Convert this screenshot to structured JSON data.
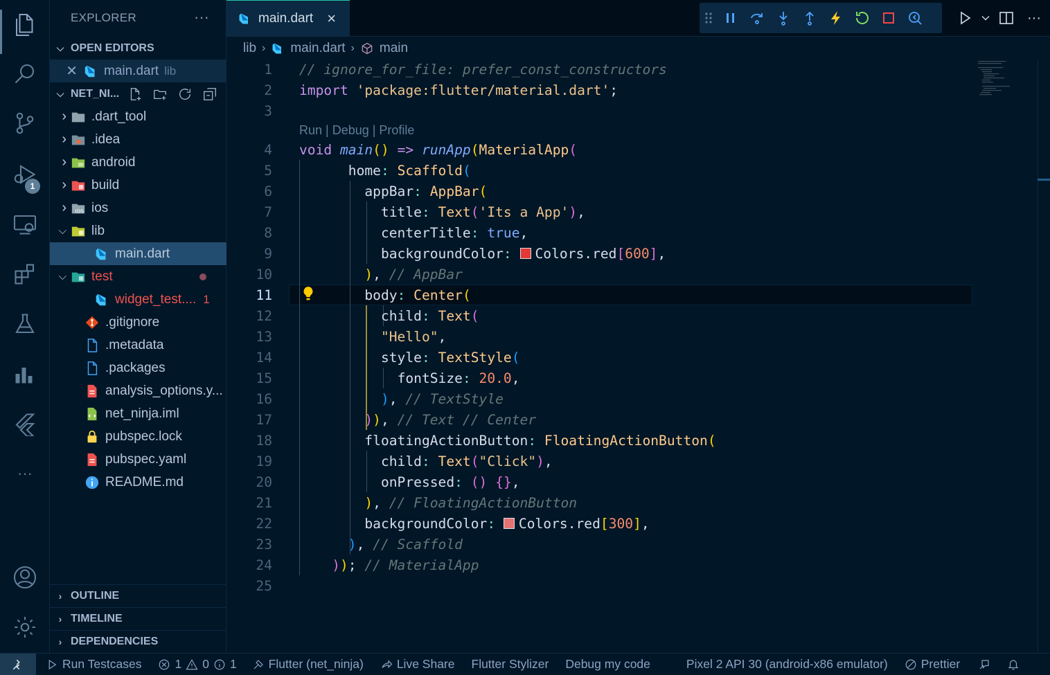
{
  "explorer": {
    "title": "EXPLORER",
    "more": "···",
    "open_editors_label": "OPEN EDITORS",
    "open_editor_file": "main.dart",
    "open_editor_dir": "lib",
    "project_label": "NET_NI...",
    "tree": [
      {
        "label": ".dart_tool",
        "icon": "folder-icon"
      },
      {
        "label": ".idea",
        "icon": "idea-folder-icon"
      },
      {
        "label": "android",
        "icon": "android-folder-icon"
      },
      {
        "label": "build",
        "icon": "build-folder-icon"
      },
      {
        "label": "ios",
        "icon": "ios-folder-icon"
      },
      {
        "label": "lib",
        "icon": "lib-folder-icon"
      },
      {
        "label": "main.dart",
        "icon": "dart-file-icon"
      },
      {
        "label": "test",
        "icon": "test-folder-icon"
      },
      {
        "label": "widget_test....",
        "icon": "dart-file-icon",
        "errors": "1"
      },
      {
        "label": ".gitignore",
        "icon": "git-icon"
      },
      {
        "label": ".metadata",
        "icon": "file-icon"
      },
      {
        "label": ".packages",
        "icon": "file-icon"
      },
      {
        "label": "analysis_options.y...",
        "icon": "yaml-icon"
      },
      {
        "label": "net_ninja.iml",
        "icon": "iml-icon"
      },
      {
        "label": "pubspec.lock",
        "icon": "lock-icon"
      },
      {
        "label": "pubspec.yaml",
        "icon": "yaml-icon"
      },
      {
        "label": "README.md",
        "icon": "info-icon"
      }
    ],
    "outline_label": "OUTLINE",
    "timeline_label": "TIMELINE",
    "dependencies_label": "DEPENDENCIES"
  },
  "activity_badge": "1",
  "tab": {
    "label": "main.dart",
    "close": "×"
  },
  "breadcrumb": {
    "folder": "lib",
    "file": "main.dart",
    "symbol": "main"
  },
  "codelens": "Run | Debug | Profile",
  "line_numbers": [
    "1",
    "2",
    "3",
    "4",
    "5",
    "6",
    "7",
    "8",
    "9",
    "10",
    "11",
    "12",
    "13",
    "14",
    "15",
    "16",
    "17",
    "18",
    "19",
    "20",
    "21",
    "22",
    "23",
    "24",
    "25"
  ],
  "code": {
    "l1": "// ignore_for_file: prefer_const_constructors",
    "l2_kw": "import",
    "l2_str": "'package:flutter/material.dart'",
    "l4_void": "void",
    "l4_main": "main",
    "l4_runapp": "runApp",
    "l4_material": "MaterialApp",
    "l5_home": "home",
    "l5_scaffold": "Scaffold",
    "l6_appbar": "appBar",
    "l6_appbar_cls": "AppBar",
    "l7_title": "title",
    "l7_text": "Text",
    "l7_str": "'Its a App'",
    "l8_center": "centerTitle",
    "l8_true": "true",
    "l9_bg": "backgroundColor",
    "l9_colors": "Colors.red",
    "l9_num": "600",
    "l10_comment": "// AppBar",
    "l11_body": "body",
    "l11_center": "Center",
    "l12_child": "child",
    "l12_text": "Text",
    "l13_str": "\"Hello\"",
    "l14_style": "style",
    "l14_ts": "TextStyle",
    "l15_fs": "fontSize",
    "l15_num": "20.0",
    "l16_comment": "// TextStyle",
    "l17_comment": "// Text // Center",
    "l18_fab": "floatingActionButton",
    "l18_fab_cls": "FloatingActionButton",
    "l19_child": "child",
    "l19_text": "Text",
    "l19_str": "\"Click\"",
    "l20_onp": "onPressed",
    "l21_comment": "// FloatingActionButton",
    "l22_bg": "backgroundColor",
    "l22_colors": "Colors.red",
    "l22_num": "300",
    "l23_comment": "// Scaffold",
    "l24_comment": "// MaterialApp"
  },
  "colors": {
    "red600": "#e53935",
    "red300": "#e57373",
    "accent": "#21c7a8"
  },
  "status": {
    "run_testcases": "Run Testcases",
    "errors": "1",
    "warnings": "0",
    "infos": "1",
    "flutter": "Flutter (net_ninja)",
    "live_share": "Live Share",
    "stylizer": "Flutter Stylizer",
    "debug_code": "Debug my code",
    "device": "Pixel 2 API 30 (android-x86 emulator)",
    "prettier": "Prettier"
  }
}
